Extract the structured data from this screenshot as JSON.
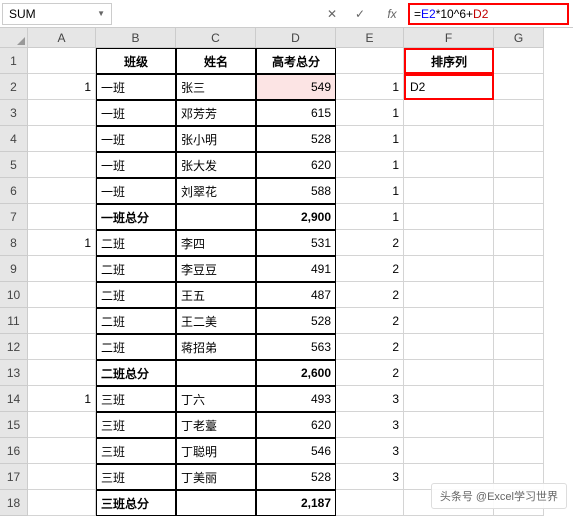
{
  "nameBox": "SUM",
  "formula": {
    "eq": "=",
    "refE": "E2",
    "op1": "*10^6+",
    "refD": "D2"
  },
  "fbIcons": {
    "cancel": "✕",
    "confirm": "✓",
    "fx": "fx"
  },
  "cols": [
    "A",
    "B",
    "C",
    "D",
    "E",
    "F",
    "G"
  ],
  "headers": {
    "B": "班级",
    "C": "姓名",
    "D": "高考总分",
    "F": "排序列"
  },
  "activeCellValue": "D2",
  "rows": [
    {
      "n": 2,
      "A": "1",
      "B": "一班",
      "C": "张三",
      "D": "549",
      "E": "1"
    },
    {
      "n": 3,
      "A": "",
      "B": "一班",
      "C": "邓芳芳",
      "D": "615",
      "E": "1"
    },
    {
      "n": 4,
      "A": "",
      "B": "一班",
      "C": "张小明",
      "D": "528",
      "E": "1"
    },
    {
      "n": 5,
      "A": "",
      "B": "一班",
      "C": "张大发",
      "D": "620",
      "E": "1"
    },
    {
      "n": 6,
      "A": "",
      "B": "一班",
      "C": "刘翠花",
      "D": "588",
      "E": "1"
    },
    {
      "n": 7,
      "A": "",
      "B": "一班总分",
      "C": "",
      "D": "2,900",
      "E": "1",
      "bold": true
    },
    {
      "n": 8,
      "A": "1",
      "B": "二班",
      "C": "李四",
      "D": "531",
      "E": "2"
    },
    {
      "n": 9,
      "A": "",
      "B": "二班",
      "C": "李豆豆",
      "D": "491",
      "E": "2"
    },
    {
      "n": 10,
      "A": "",
      "B": "二班",
      "C": "王五",
      "D": "487",
      "E": "2"
    },
    {
      "n": 11,
      "A": "",
      "B": "二班",
      "C": "王二美",
      "D": "528",
      "E": "2"
    },
    {
      "n": 12,
      "A": "",
      "B": "二班",
      "C": "蒋招弟",
      "D": "563",
      "E": "2"
    },
    {
      "n": 13,
      "A": "",
      "B": "二班总分",
      "C": "",
      "D": "2,600",
      "E": "2",
      "bold": true
    },
    {
      "n": 14,
      "A": "1",
      "B": "三班",
      "C": "丁六",
      "D": "493",
      "E": "3"
    },
    {
      "n": 15,
      "A": "",
      "B": "三班",
      "C": "丁老薹",
      "D": "620",
      "E": "3"
    },
    {
      "n": 16,
      "A": "",
      "B": "三班",
      "C": "丁聪明",
      "D": "546",
      "E": "3"
    },
    {
      "n": 17,
      "A": "",
      "B": "三班",
      "C": "丁美丽",
      "D": "528",
      "E": "3"
    },
    {
      "n": 18,
      "A": "",
      "B": "三班总分",
      "C": "",
      "D": "2,187",
      "E": "",
      "bold": true
    }
  ],
  "watermark": "头条号 @Excel学习世界",
  "chart_data": {
    "type": "table",
    "title": "高考总分",
    "columns": [
      "班级",
      "姓名",
      "高考总分",
      "排序列"
    ],
    "data": [
      [
        "一班",
        "张三",
        549,
        1
      ],
      [
        "一班",
        "邓芳芳",
        615,
        1
      ],
      [
        "一班",
        "张小明",
        528,
        1
      ],
      [
        "一班",
        "张大发",
        620,
        1
      ],
      [
        "一班",
        "刘翠花",
        588,
        1
      ],
      [
        "一班总分",
        "",
        2900,
        1
      ],
      [
        "二班",
        "李四",
        531,
        2
      ],
      [
        "二班",
        "李豆豆",
        491,
        2
      ],
      [
        "二班",
        "王五",
        487,
        2
      ],
      [
        "二班",
        "王二美",
        528,
        2
      ],
      [
        "二班",
        "蒋招弟",
        563,
        2
      ],
      [
        "二班总分",
        "",
        2600,
        2
      ],
      [
        "三班",
        "丁六",
        493,
        3
      ],
      [
        "三班",
        "丁老薹",
        620,
        3
      ],
      [
        "三班",
        "丁聪明",
        546,
        3
      ],
      [
        "三班",
        "丁美丽",
        528,
        3
      ],
      [
        "三班总分",
        "",
        2187,
        null
      ]
    ]
  }
}
